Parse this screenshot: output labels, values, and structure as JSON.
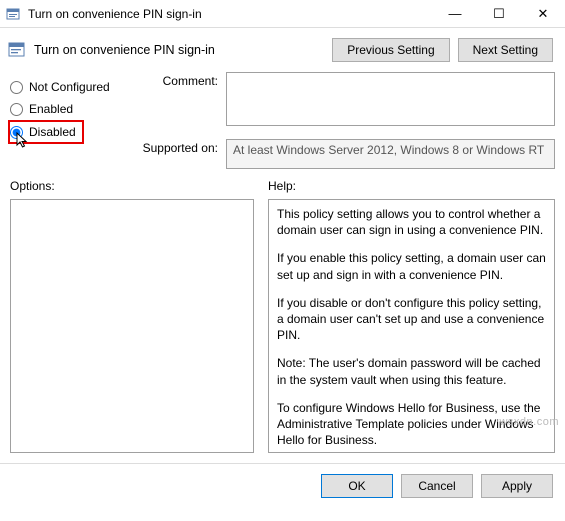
{
  "window": {
    "title": "Turn on convenience PIN sign-in",
    "minimize": "—",
    "maximize": "☐",
    "close": "✕"
  },
  "header": {
    "title": "Turn on convenience PIN sign-in",
    "prev": "Previous Setting",
    "next": "Next Setting"
  },
  "state": {
    "not_configured": "Not Configured",
    "enabled": "Enabled",
    "disabled": "Disabled",
    "selected": "disabled"
  },
  "fields": {
    "comment_label": "Comment:",
    "comment_value": "",
    "supported_label": "Supported on:",
    "supported_value": "At least Windows Server 2012, Windows 8 or Windows RT"
  },
  "sections": {
    "options_label": "Options:",
    "help_label": "Help:"
  },
  "help_paragraphs": [
    "This policy setting allows you to control whether a domain user can sign in using a convenience PIN.",
    "If you enable this policy setting, a domain user can set up and sign in with a convenience PIN.",
    "If you disable or don't configure this policy setting, a domain user can't set up and use a convenience PIN.",
    "Note: The user's domain password will be cached in the system vault when using this feature.",
    "To configure Windows Hello for Business, use the Administrative Template policies under Windows Hello for Business."
  ],
  "footer": {
    "ok": "OK",
    "cancel": "Cancel",
    "apply": "Apply"
  },
  "watermark": "wsxdn.com"
}
